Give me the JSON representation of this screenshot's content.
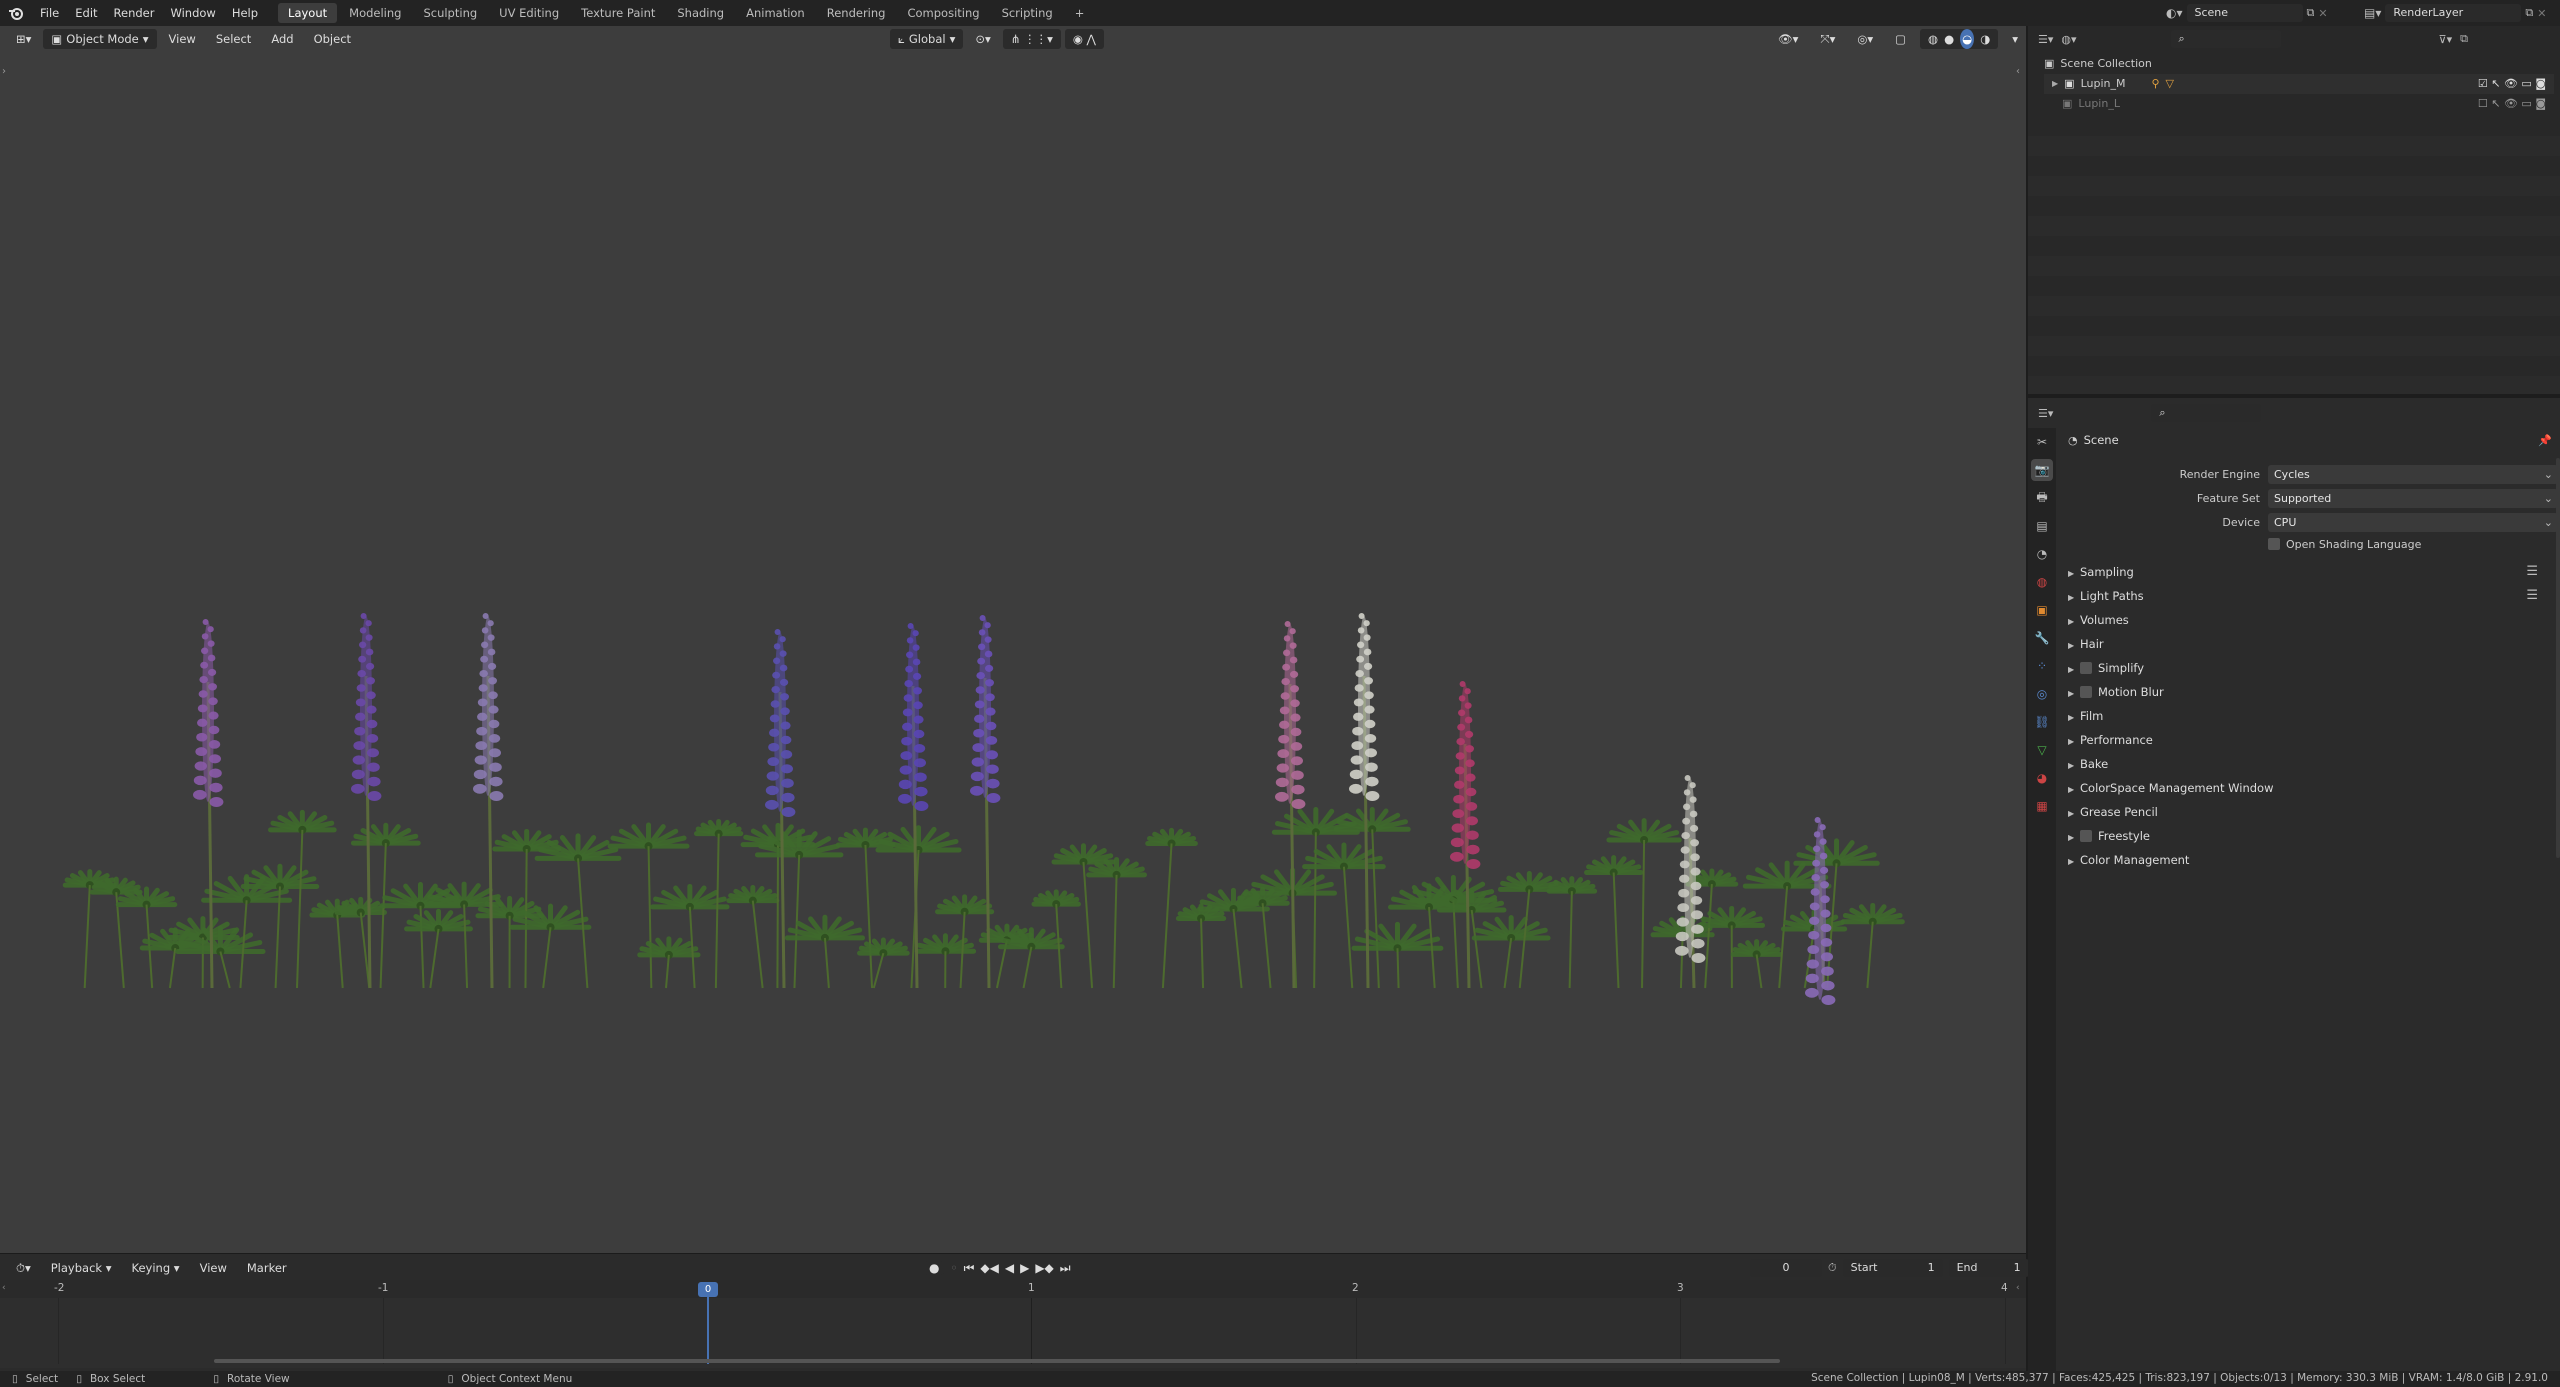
{
  "topbar": {
    "menus": [
      "File",
      "Edit",
      "Render",
      "Window",
      "Help"
    ],
    "workspaces": [
      "Layout",
      "Modeling",
      "Sculpting",
      "UV Editing",
      "Texture Paint",
      "Shading",
      "Animation",
      "Rendering",
      "Compositing",
      "Scripting"
    ],
    "active_workspace": "Layout",
    "add_tab": "+",
    "scene_name": "Scene",
    "view_layer": "RenderLayer"
  },
  "viewport": {
    "mode": "Object Mode",
    "menus": [
      "View",
      "Select",
      "Add",
      "Object"
    ],
    "transform_orientation": "Global",
    "background": "#3d3d3d"
  },
  "timeline": {
    "menus": [
      "Playback",
      "Keying",
      "View",
      "Marker"
    ],
    "current_frame": "0",
    "start_label": "Start",
    "start_value": "1",
    "end_label": "End",
    "end_value": "1",
    "ticks": [
      "-2",
      "-1",
      "0",
      "1",
      "2",
      "3",
      "4"
    ],
    "playhead_label": "0"
  },
  "statusbar": {
    "select": "Select",
    "box_select": "Box Select",
    "rotate_view": "Rotate View",
    "context_menu": "Object Context Menu",
    "stats": "Scene Collection | Lupin08_M | Verts:485,377 | Faces:425,425 | Tris:823,197 | Objects:0/13 | Memory: 330.3 MiB | VRAM: 1.4/8.0 GiB | 2.91.0"
  },
  "outliner": {
    "root": "Scene Collection",
    "items": [
      {
        "name": "Lupin_M",
        "visible": true
      },
      {
        "name": "Lupin_L",
        "visible": false
      }
    ]
  },
  "properties": {
    "context": "Scene",
    "fields": [
      {
        "label": "Render Engine",
        "value": "Cycles"
      },
      {
        "label": "Feature Set",
        "value": "Supported"
      },
      {
        "label": "Device",
        "value": "CPU"
      }
    ],
    "osl_label": "Open Shading Language",
    "panels": [
      {
        "label": "Sampling",
        "checkbox": false,
        "list": true
      },
      {
        "label": "Light Paths",
        "checkbox": false,
        "list": true
      },
      {
        "label": "Volumes",
        "checkbox": false,
        "list": false
      },
      {
        "label": "Hair",
        "checkbox": false,
        "list": false
      },
      {
        "label": "Simplify",
        "checkbox": true,
        "list": false
      },
      {
        "label": "Motion Blur",
        "checkbox": true,
        "list": false
      },
      {
        "label": "Film",
        "checkbox": false,
        "list": false
      },
      {
        "label": "Performance",
        "checkbox": false,
        "list": false
      },
      {
        "label": "Bake",
        "checkbox": false,
        "list": false
      },
      {
        "label": "ColorSpace Management Window",
        "checkbox": false,
        "list": false
      },
      {
        "label": "Grease Pencil",
        "checkbox": false,
        "list": false
      },
      {
        "label": "Freestyle",
        "checkbox": true,
        "list": false
      },
      {
        "label": "Color Management",
        "checkbox": false,
        "list": false
      }
    ]
  },
  "colors": {
    "accent": "#4772b3",
    "stem": "#5a6a3a"
  },
  "plants": [
    {
      "group": "cluster-1",
      "flowers": [
        "#8a5aa8",
        "#6a48a8",
        "#8a7ab0"
      ]
    },
    {
      "group": "cluster-2",
      "flowers": [
        "#5a50b0",
        "#5a46b4",
        "#6a50b8"
      ]
    },
    {
      "group": "cluster-3",
      "flowers": [
        "#b06a98",
        "#d0d0c8",
        "#b03a6a"
      ]
    },
    {
      "group": "cluster-4",
      "flowers": [
        "#c8c8c0",
        "#8a6ab8"
      ]
    }
  ]
}
